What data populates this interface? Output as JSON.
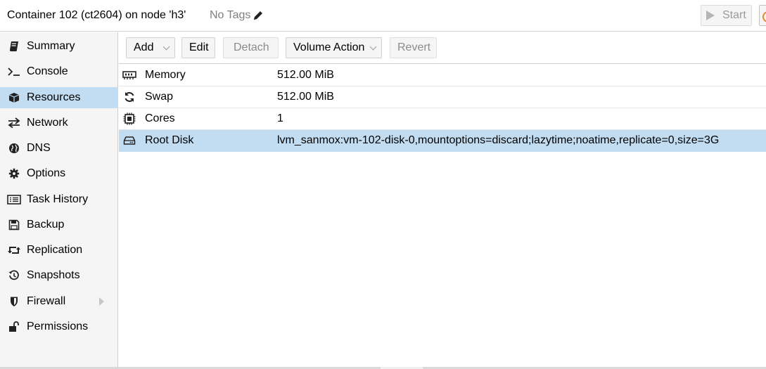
{
  "header": {
    "title": "Container 102 (ct2604) on node 'h3'",
    "tags_label": "No Tags",
    "start_label": "Start"
  },
  "sidebar": {
    "items": [
      {
        "label": "Summary",
        "icon": "book-icon"
      },
      {
        "label": "Console",
        "icon": "terminal-icon"
      },
      {
        "label": "Resources",
        "icon": "cube-icon",
        "active": true
      },
      {
        "label": "Network",
        "icon": "exchange-icon"
      },
      {
        "label": "DNS",
        "icon": "globe-icon"
      },
      {
        "label": "Options",
        "icon": "gear-icon"
      },
      {
        "label": "Task History",
        "icon": "list-icon"
      },
      {
        "label": "Backup",
        "icon": "floppy-icon"
      },
      {
        "label": "Replication",
        "icon": "retweet-icon"
      },
      {
        "label": "Snapshots",
        "icon": "history-icon"
      },
      {
        "label": "Firewall",
        "icon": "shield-icon",
        "expandable": true
      },
      {
        "label": "Permissions",
        "icon": "unlock-icon"
      }
    ]
  },
  "toolbar": {
    "add_label": "Add",
    "edit_label": "Edit",
    "detach_label": "Detach",
    "volume_action_label": "Volume Action",
    "revert_label": "Revert"
  },
  "resources": [
    {
      "key": "Memory",
      "value": "512.00 MiB",
      "icon": "memory-icon"
    },
    {
      "key": "Swap",
      "value": "512.00 MiB",
      "icon": "refresh-icon"
    },
    {
      "key": "Cores",
      "value": "1",
      "icon": "cpu-icon"
    },
    {
      "key": "Root Disk",
      "value": "lvm_sanmox:vm-102-disk-0,mountoptions=discard;lazytime;noatime,replicate=0,size=3G",
      "icon": "hdd-icon",
      "selected": true
    }
  ],
  "colors": {
    "selection": "#c2ddf2",
    "sidebar_bg": "#f5f5f5",
    "border": "#cfcfcf"
  }
}
